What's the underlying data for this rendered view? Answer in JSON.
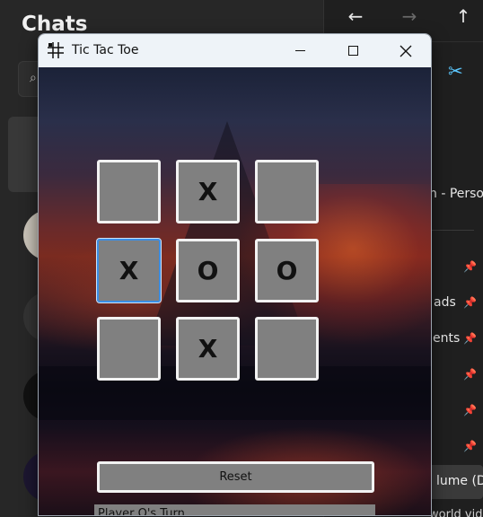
{
  "chats_app": {
    "title": "Chats"
  },
  "explorer": {
    "partial_item": "n - Perso",
    "quick_access": [
      "ads",
      "ents"
    ],
    "drive_label": "lume (D:",
    "drive_partial_below": "world video"
  },
  "window": {
    "title": "Tic Tac Toe",
    "minimize_icon": "minimize-icon",
    "maximize_icon": "maximize-icon",
    "close_icon": "close-icon"
  },
  "board": {
    "cells": [
      {
        "value": ""
      },
      {
        "value": "X"
      },
      {
        "value": ""
      },
      {
        "value": "X"
      },
      {
        "value": "O"
      },
      {
        "value": "O"
      },
      {
        "value": ""
      },
      {
        "value": "X"
      },
      {
        "value": ""
      }
    ],
    "focused_cell": 3
  },
  "controls": {
    "reset_label": "Reset",
    "status_text": "Player O's Turn"
  },
  "colors": {
    "cell_bg": "#808080",
    "cell_border": "#f2f2f2",
    "focus_border": "#3a8ee6",
    "titlebar_bg": "#eef3f8",
    "cut_icon_accent": "#5cc8ff"
  }
}
